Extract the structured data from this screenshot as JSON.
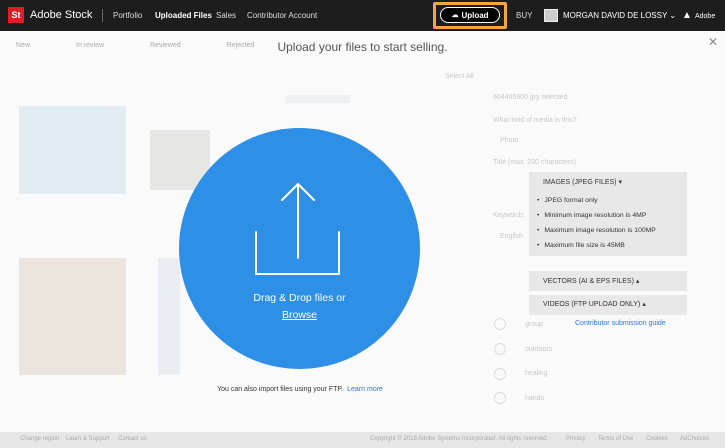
{
  "topbar": {
    "logo_mark": "St",
    "brand": "Adobe Stock",
    "nav": [
      "Portfolio",
      "Uploaded Files",
      "Sales",
      "Contributor Account"
    ],
    "upload_label": "Upload",
    "buy_label": "BUY",
    "user_name": "MORGAN DAVID DE LOSSY",
    "adobe_label": "Adobe"
  },
  "background": {
    "tabs": [
      "New",
      "In review",
      "Reviewed",
      "Rejected"
    ],
    "select_all": "Select All",
    "file_name": "604465900.jpg selected",
    "media_question": "What kind of media is this?",
    "media_value": "Photo",
    "title_label": "Title (max. 200 characters)",
    "keywords_label": "Keywords",
    "language": "English",
    "keywords_list": [
      "group",
      "outdoors",
      "healing",
      "hands"
    ],
    "footer_left": [
      "Change region",
      "Learn & Support",
      "Contact us"
    ],
    "footer_right": [
      "Copyright © 2018 Adobe Systems Incorporated. All rights reserved.",
      "Privacy",
      "Terms of Use",
      "Cookies",
      "AdChoices"
    ]
  },
  "overlay": {
    "title": "Upload your files to start selling.",
    "drop_text": "Drag & Drop files or",
    "browse": "Browse",
    "ftp_text": "You can also import files using your FTP.",
    "learn_more": "Learn more"
  },
  "info_panel": {
    "images_header": "IMAGES (JPEG FILES)",
    "image_rules": [
      "JPEG format only",
      "Minimum image resolution is 4MP",
      "Maximum image resolution is 100MP",
      "Maximum file size is 45MB"
    ],
    "vectors_header": "VECTORS (AI & EPS FILES)",
    "videos_header": "VIDEOS (FTP UPLOAD ONLY)",
    "guide_link": "Contributor submission guide"
  },
  "colors": {
    "accent_blue": "#2d8fe6",
    "highlight_orange": "#f3a63a",
    "topbar": "#1d1d1d",
    "brand_red": "#da1f26"
  }
}
